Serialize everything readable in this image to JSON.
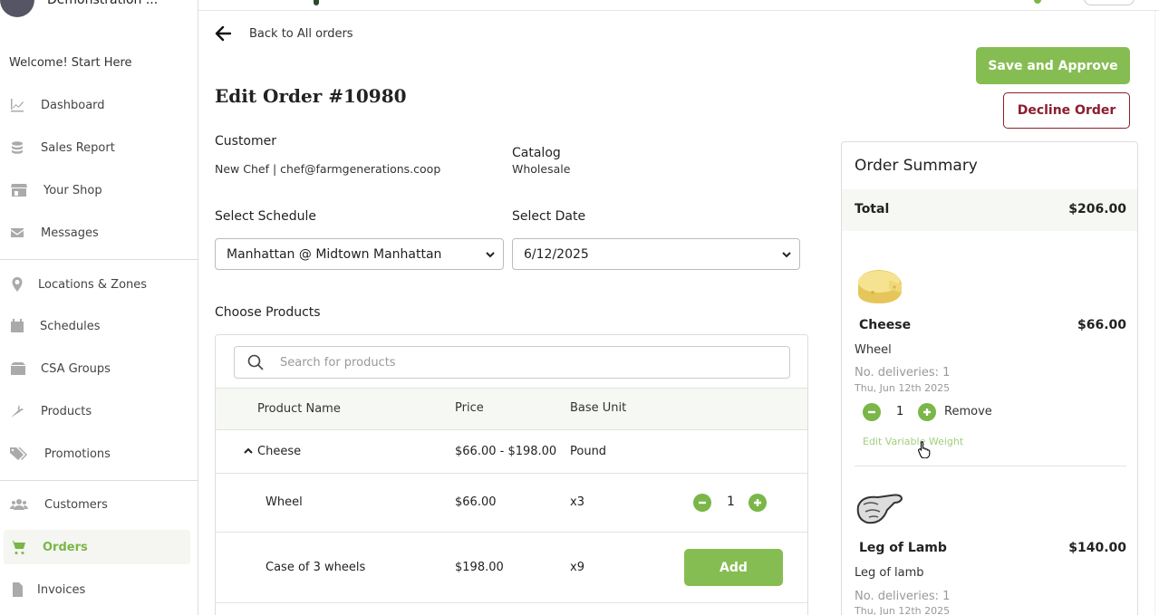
{
  "sidebar": {
    "org_name": "Demonstration ...",
    "welcome": "Welcome! Start Here",
    "items": [
      {
        "label": "Dashboard",
        "icon": "chart-line-icon"
      },
      {
        "label": "Sales Report",
        "icon": "coins-icon"
      },
      {
        "label": "Your Shop",
        "icon": "store-icon"
      },
      {
        "label": "Messages",
        "icon": "envelope-icon"
      },
      {
        "label": "Locations & Zones",
        "icon": "map-pin-icon"
      },
      {
        "label": "Schedules",
        "icon": "calendar-icon"
      },
      {
        "label": "CSA Groups",
        "icon": "box-icon"
      },
      {
        "label": "Products",
        "icon": "carrot-icon"
      },
      {
        "label": "Promotions",
        "icon": "tags-icon"
      },
      {
        "label": "Customers",
        "icon": "users-icon"
      },
      {
        "label": "Orders",
        "icon": "cart-icon"
      },
      {
        "label": "Invoices",
        "icon": "file-icon"
      }
    ],
    "active": "Orders"
  },
  "header": {
    "back_label": "Back to All orders",
    "title": "Edit Order #10980"
  },
  "actions": {
    "approve_label": "Save and Approve",
    "decline_label": "Decline Order"
  },
  "customer": {
    "label": "Customer",
    "value": "New Chef | chef@farmgenerations.coop"
  },
  "catalog": {
    "label": "Catalog",
    "value": "Wholesale"
  },
  "schedule": {
    "label": "Select Schedule",
    "value": "Manhattan @ Midtown Manhattan"
  },
  "date": {
    "label": "Select Date",
    "value": "6/12/2025"
  },
  "products": {
    "heading": "Choose Products",
    "search_placeholder": "Search for products",
    "columns": [
      "Product Name",
      "Price",
      "Base Unit"
    ],
    "group": {
      "name": "Cheese",
      "price": "$66.00 - $198.00",
      "unit": "Pound"
    },
    "variants": [
      {
        "name": "Wheel",
        "price": "$66.00",
        "unit": "x3",
        "qty": "1"
      },
      {
        "name": "Case of 3 wheels",
        "price": "$198.00",
        "unit": "x9",
        "action": "Add"
      }
    ]
  },
  "summary": {
    "title": "Order Summary",
    "total_label": "Total",
    "total_value": "$206.00",
    "items": [
      {
        "name": "Cheese",
        "price": "$66.00",
        "variant": "Wheel",
        "deliveries": "No. deliveries: 1",
        "date": "Thu, Jun 12th 2025",
        "qty": "1",
        "remove_label": "Remove",
        "edit_label": "Edit Variable Weight"
      },
      {
        "name": "Leg of Lamb",
        "price": "$140.00",
        "variant": "Leg of lamb",
        "deliveries": "No. deliveries: 1",
        "date": "Thu, Jun 12th 2025"
      }
    ]
  },
  "colors": {
    "accent": "#86bd52",
    "decline": "#8c1d2e"
  }
}
